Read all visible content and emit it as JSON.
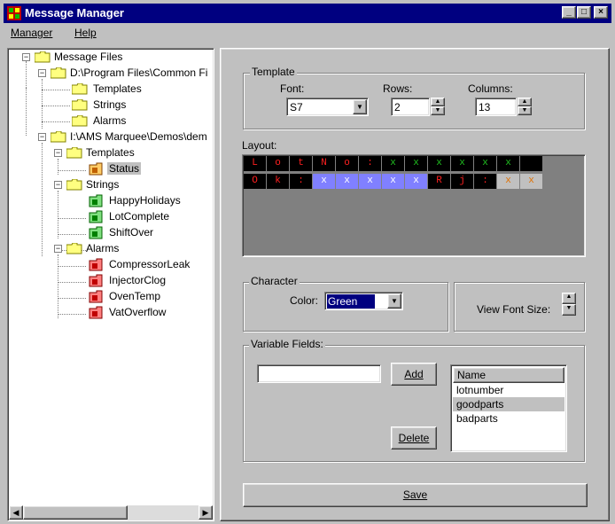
{
  "window": {
    "title": "Message Manager"
  },
  "menubar": {
    "items": [
      "Manager",
      "Help"
    ]
  },
  "tree": {
    "root": "Message Files",
    "path1": "D:\\Program Files\\Common Fi",
    "path1_children": [
      "Templates",
      "Strings",
      "Alarms"
    ],
    "path2": "I:\\AMS Marquee\\Demos\\dem",
    "templates": "Templates",
    "templates_children": [
      "Status"
    ],
    "strings": "Strings",
    "strings_children": [
      "HappyHolidays",
      "LotComplete",
      "ShiftOver"
    ],
    "alarms": "Alarms",
    "alarms_children": [
      "CompressorLeak",
      "InjectorClog",
      "OvenTemp",
      "VatOverflow"
    ],
    "selected": "Status"
  },
  "template": {
    "group_label": "Template",
    "font_label": "Font:",
    "font_value": "S7",
    "rows_label": "Rows:",
    "rows_value": "2",
    "columns_label": "Columns:",
    "columns_value": "13"
  },
  "layout": {
    "label": "Layout:",
    "rows": [
      [
        [
          "L",
          "r"
        ],
        [
          "o",
          "r"
        ],
        [
          "t",
          "r"
        ],
        [
          "N",
          "r"
        ],
        [
          "o",
          "r"
        ],
        [
          ":",
          "r"
        ],
        [
          "x",
          "g"
        ],
        [
          "x",
          "g"
        ],
        [
          "x",
          "g"
        ],
        [
          "x",
          "g"
        ],
        [
          "x",
          "g"
        ],
        [
          "x",
          "g"
        ],
        [
          "",
          "b"
        ]
      ],
      [
        [
          "O",
          "r"
        ],
        [
          "k",
          "r"
        ],
        [
          ":",
          "r"
        ],
        [
          "x",
          "v"
        ],
        [
          "x",
          "v"
        ],
        [
          "x",
          "v"
        ],
        [
          "x",
          "v"
        ],
        [
          "x",
          "v"
        ],
        [
          "R",
          "r"
        ],
        [
          "j",
          "r"
        ],
        [
          ":",
          "r"
        ],
        [
          "x",
          "o"
        ],
        [
          "x",
          "o"
        ]
      ]
    ],
    "colors": {
      "r": "#ff2020",
      "g": "#20c020",
      "v": "#ffffff",
      "o": "#e07000",
      "bg": "#000000",
      "sel_bg": "#8080ff",
      "cell_gray": "#c0c0c0"
    }
  },
  "character": {
    "group_label": "Character",
    "color_label": "Color:",
    "color_value": "Green",
    "view_font_size_label": "View Font Size:"
  },
  "variables": {
    "group_label": "Variable Fields:",
    "input_value": "",
    "add_label": "Add",
    "delete_label": "Delete",
    "list_header": "Name",
    "items": [
      "lotnumber",
      "goodparts",
      "badparts"
    ],
    "selected": "goodparts"
  },
  "save_label": "Save"
}
